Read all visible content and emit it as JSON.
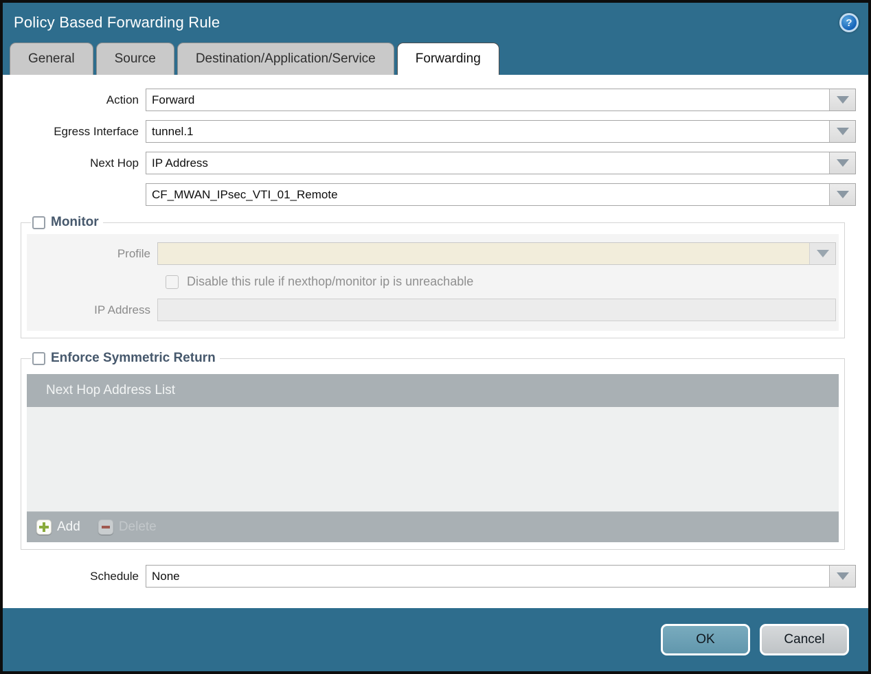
{
  "window": {
    "title": "Policy Based Forwarding Rule",
    "help_glyph": "?"
  },
  "tabs": [
    {
      "label": "General",
      "active": false
    },
    {
      "label": "Source",
      "active": false
    },
    {
      "label": "Destination/Application/Service",
      "active": false
    },
    {
      "label": "Forwarding",
      "active": true
    }
  ],
  "form": {
    "action": {
      "label": "Action",
      "value": "Forward"
    },
    "egress_interface": {
      "label": "Egress Interface",
      "value": "tunnel.1"
    },
    "next_hop": {
      "label": "Next Hop",
      "value": "IP Address"
    },
    "next_hop_address": {
      "value": "CF_MWAN_IPsec_VTI_01_Remote"
    },
    "schedule": {
      "label": "Schedule",
      "value": "None"
    }
  },
  "monitor": {
    "legend": "Monitor",
    "checked": false,
    "profile": {
      "label": "Profile",
      "value": ""
    },
    "disable_rule": {
      "label": "Disable this rule if nexthop/monitor ip is unreachable",
      "checked": false
    },
    "ip_address": {
      "label": "IP Address",
      "value": ""
    }
  },
  "symmetric_return": {
    "legend": "Enforce Symmetric Return",
    "checked": false,
    "table": {
      "header": "Next Hop Address List",
      "rows": []
    },
    "add_label": "Add",
    "delete_label": "Delete",
    "delete_enabled": false
  },
  "footer": {
    "ok_label": "OK",
    "cancel_label": "Cancel"
  },
  "colors": {
    "titlebar": "#2e6d8d",
    "active_tab": "#ffffff",
    "inactive_tab": "#c9c9c9",
    "table_header": "#a9b0b4",
    "table_body": "#eef0f0",
    "profile_field": "#f2eddb",
    "add_plus": "#8aab3c",
    "delete_minus": "#a05a50",
    "ok_button": "#6aa0b6",
    "cancel_button": "#c9cdd0",
    "legend_text": "#46586c"
  }
}
